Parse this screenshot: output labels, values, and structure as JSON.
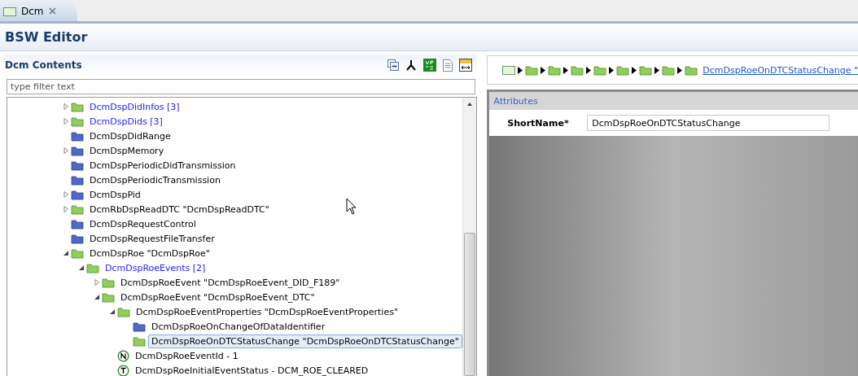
{
  "editor_tab": {
    "label": "Dcm",
    "selected": true
  },
  "editor": {
    "title": "BSW Editor"
  },
  "contents": {
    "title": "Dcm Contents",
    "filter": {
      "placeholder": "type filter text"
    },
    "tree": [
      {
        "label": "DcmDspDidInfos [3]",
        "kind": "container",
        "emphasized": true,
        "expanded": false,
        "selected": false
      },
      {
        "label": "DcmDspDids [3]",
        "kind": "container",
        "emphasized": true,
        "expanded": false,
        "selected": false
      },
      {
        "label": "DcmDspDidRange",
        "kind": "folder",
        "emphasized": false,
        "selected": false
      },
      {
        "label": "DcmDspMemory",
        "kind": "folder",
        "emphasized": false,
        "expanded": false,
        "selected": false
      },
      {
        "label": "DcmDspPeriodicDidTransmission",
        "kind": "folder",
        "emphasized": false,
        "selected": false
      },
      {
        "label": "DcmDspPeriodicTransmission",
        "kind": "folder",
        "emphasized": false,
        "selected": false
      },
      {
        "label": "DcmDspPid",
        "kind": "folder",
        "emphasized": false,
        "expanded": false,
        "selected": false
      },
      {
        "label": "DcmRbDspReadDTC \"DcmDspReadDTC\"",
        "kind": "container",
        "emphasized": false,
        "expanded": false,
        "selected": false
      },
      {
        "label": "DcmDspRequestControl",
        "kind": "folder",
        "emphasized": false,
        "selected": false
      },
      {
        "label": "DcmDspRequestFileTransfer",
        "kind": "folder",
        "emphasized": false,
        "selected": false
      },
      {
        "label": "DcmDspRoe \"DcmDspRoe\"",
        "kind": "container",
        "emphasized": false,
        "expanded": true,
        "selected": false,
        "children": [
          {
            "label": "DcmDspRoeEvents [2]",
            "kind": "container",
            "emphasized": true,
            "expanded": true,
            "selected": false,
            "children": [
              {
                "label": "DcmDspRoeEvent \"DcmDspRoeEvent_DID_F189\"",
                "kind": "container",
                "emphasized": false,
                "expanded": false,
                "selected": false
              },
              {
                "label": "DcmDspRoeEvent \"DcmDspRoeEvent_DTC\"",
                "kind": "container",
                "emphasized": false,
                "expanded": true,
                "selected": false,
                "children": [
                  {
                    "label": "DcmDspRoeEventProperties \"DcmDspRoeEventProperties\"",
                    "kind": "container",
                    "emphasized": false,
                    "expanded": true,
                    "selected": false,
                    "children": [
                      {
                        "label": "DcmDspRoeOnChangeOfDataIdentifier",
                        "kind": "folder",
                        "emphasized": false,
                        "selected": false
                      },
                      {
                        "label": "DcmDspRoeOnDTCStatusChange \"DcmDspRoeOnDTCStatusChange\"",
                        "kind": "container",
                        "emphasized": false,
                        "selected": true
                      }
                    ]
                  },
                  {
                    "label": "DcmDspRoeEventId - 1",
                    "kind": "numeric",
                    "emphasized": false,
                    "selected": false
                  },
                  {
                    "label": "DcmDspRoeInitialEventStatus - DCM_ROE_CLEARED",
                    "kind": "textual",
                    "emphasized": false,
                    "selected": false
                  }
                ]
              }
            ]
          }
        ]
      }
    ]
  },
  "breadcrumb": [
    {
      "kind": "editor"
    },
    {
      "kind": "folder"
    },
    {
      "kind": "folder"
    },
    {
      "kind": "folder"
    },
    {
      "kind": "folder"
    },
    {
      "kind": "folder"
    },
    {
      "kind": "folder"
    },
    {
      "kind": "folder"
    },
    {
      "kind": "link",
      "label": "DcmDspRoeOnDTCStatusChange \""
    }
  ],
  "attributes": {
    "title": "Attributes",
    "fields": [
      {
        "label": "ShortName*",
        "value": "DcmDspRoeOnDTCStatusChange"
      }
    ]
  }
}
